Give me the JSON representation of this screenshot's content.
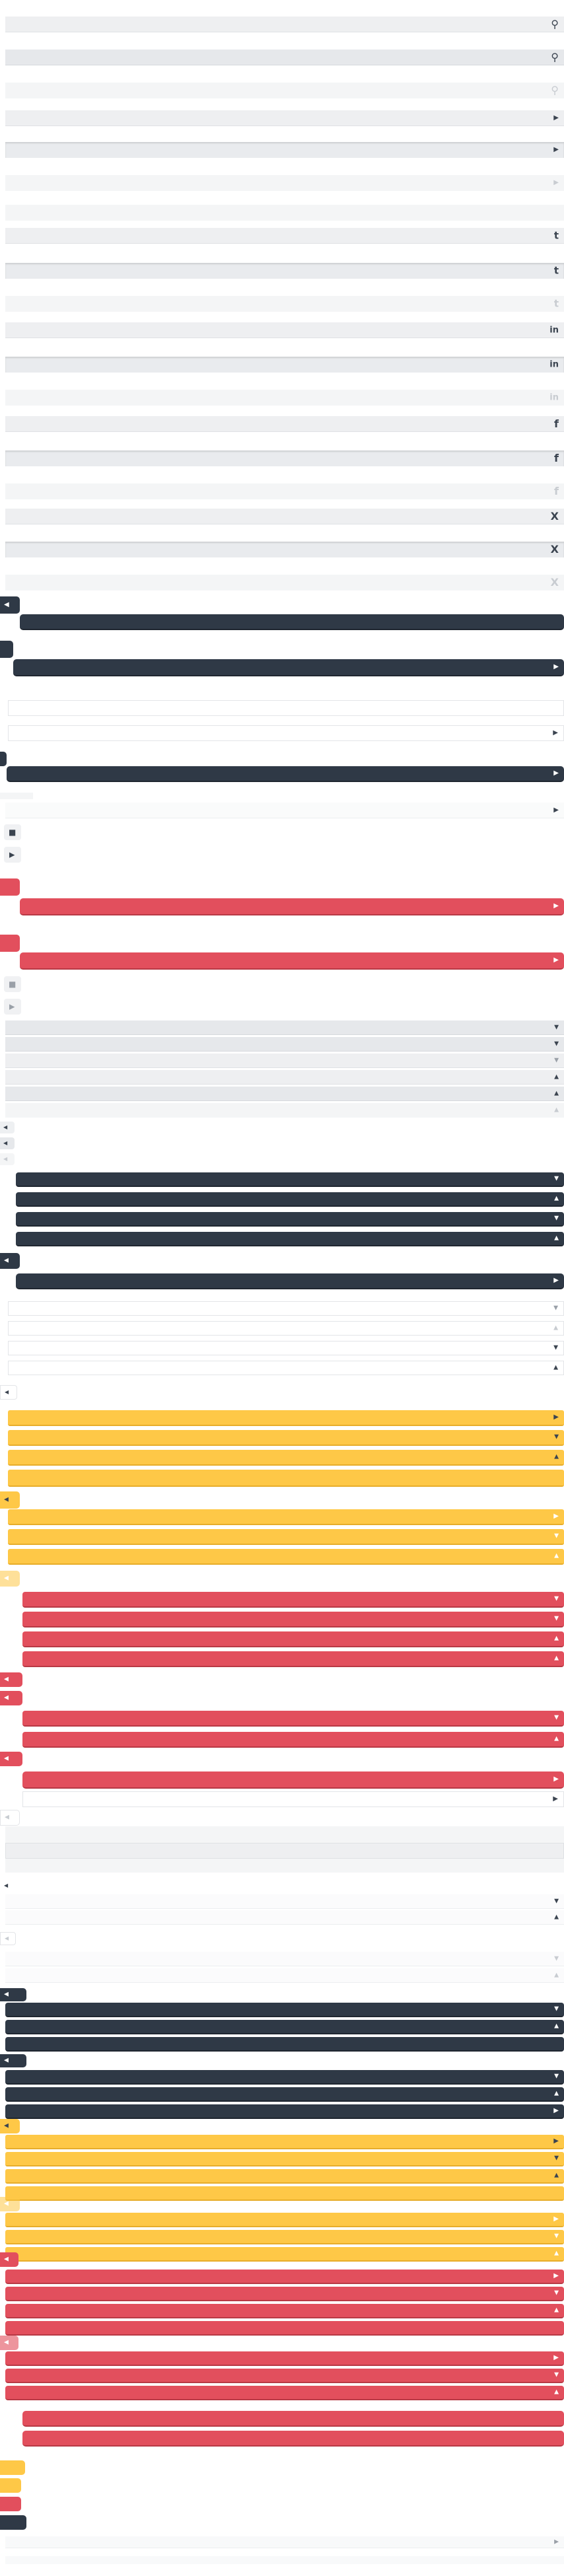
{
  "theme": {
    "dark": "#2f3946",
    "red": "#e24f5d",
    "yellow": "#fec847",
    "gray": "#eeeff1"
  },
  "icons": {
    "search": "⚲",
    "play": "▶",
    "left": "◀",
    "down": "▼",
    "up": "▲",
    "stop": "■",
    "twitter": "t",
    "linkedin": "in",
    "facebook": "f",
    "xing": "X"
  }
}
